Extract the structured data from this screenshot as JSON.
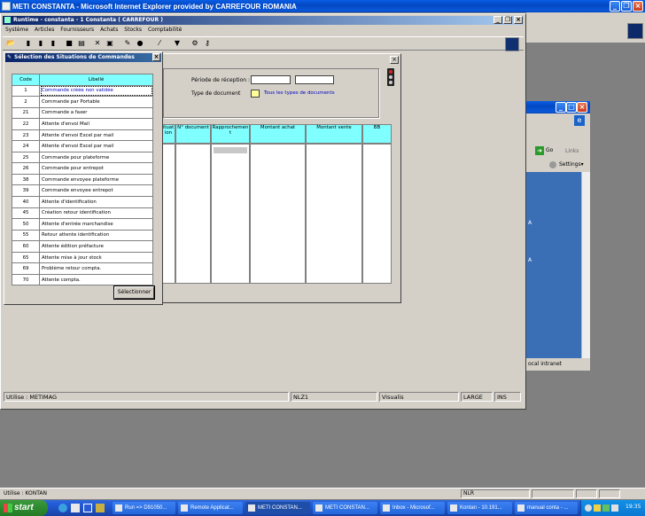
{
  "main_window": {
    "title": "METI CONSTANTA - Microsoft Internet Explorer provided by CARREFOUR ROMANIA",
    "status_user": "Utilise : KONTAN",
    "status_code": "NLR"
  },
  "runtime_window": {
    "title": "Runtime - constanta - 1 Constanta ( CARREFOUR )",
    "menu": [
      "Système",
      "Articles",
      "Fournisseurs",
      "Achats",
      "Stocks",
      "Comptabilité"
    ],
    "status": {
      "user": "Utilise : METIMAG",
      "code": "NLZ1",
      "mode": "Visualis",
      "size": "LARGE",
      "ins": "INS"
    }
  },
  "order_panel": {
    "periode_label": "Période de réception :",
    "type_label": "Type de document",
    "type_value": "Tous les types de documents",
    "columns": [
      "ituat\nion",
      "N° document",
      "Rapprochemen\nt",
      "Montant achat",
      "Montant vente",
      "BB"
    ]
  },
  "selection_dialog": {
    "title": "Sélection des Situations de Commandes",
    "col_code": "Code",
    "col_libelle": "Libellé",
    "rows": [
      {
        "code": "1",
        "label": "Commande créée non validée"
      },
      {
        "code": "2",
        "label": "Commande par Portable"
      },
      {
        "code": "21",
        "label": "Commande a faxer"
      },
      {
        "code": "22",
        "label": "Attente d'envoi Mail"
      },
      {
        "code": "23",
        "label": "Attente d'envoi Excel par mail"
      },
      {
        "code": "24",
        "label": "Attente d'envoi Excel par mail"
      },
      {
        "code": "25",
        "label": "Commande pour plateforme"
      },
      {
        "code": "26",
        "label": "Commande pour entrepot"
      },
      {
        "code": "38",
        "label": "Commande envoyee plateforme"
      },
      {
        "code": "39",
        "label": "Commande envoyee entrepot"
      },
      {
        "code": "40",
        "label": "Attente d'identification"
      },
      {
        "code": "45",
        "label": "Création retour identification"
      },
      {
        "code": "50",
        "label": "Attente d'entrée marchandise"
      },
      {
        "code": "55",
        "label": "Retour attente identification"
      },
      {
        "code": "60",
        "label": "Attente édition préfacture"
      },
      {
        "code": "65",
        "label": "Attente mise à jour stock"
      },
      {
        "code": "69",
        "label": "Problème retour compta."
      },
      {
        "code": "70",
        "label": "Attente compta."
      }
    ],
    "button": "Sélectionner"
  },
  "background_ie": {
    "go": "Go",
    "links": "Links",
    "settings": "Settings",
    "zone": "ocal intranet",
    "side_a1": "A",
    "side_a2": "A"
  },
  "taskbar": {
    "start": "start",
    "tasks": [
      "Run => D91050...",
      "Remote Applicat...",
      "METI CONSTAN...",
      "METI CONSTAN...",
      "Inbox - Microsof...",
      "Kontan - 10.191...",
      "manual conta - ..."
    ],
    "clock": "19:35"
  }
}
